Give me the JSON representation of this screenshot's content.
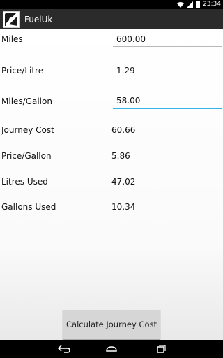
{
  "status_bar": {
    "time": "23:34",
    "icons": [
      "wifi-icon",
      "signal-icon",
      "battery-icon"
    ]
  },
  "action_bar": {
    "title": "FuelUk",
    "icon": "fuel-pump-icon"
  },
  "inputs": {
    "miles": {
      "label": "Miles",
      "value": "600.00"
    },
    "price_litre": {
      "label": "Price/Litre",
      "value": "1.29"
    },
    "miles_gallon": {
      "label": "Miles/Gallon",
      "value": "58.00"
    }
  },
  "results": {
    "journey_cost": {
      "label": "Journey Cost",
      "value": "60.66"
    },
    "price_gallon": {
      "label": "Price/Gallon",
      "value": "5.86"
    },
    "litres_used": {
      "label": "Litres Used",
      "value": "47.02"
    },
    "gallons_used": {
      "label": "Gallons Used",
      "value": "10.34"
    }
  },
  "button": {
    "label": "Calculate Journey Cost"
  },
  "nav_bar": {
    "icons": [
      "back-icon",
      "home-icon",
      "recents-icon"
    ]
  },
  "colors": {
    "accent": "#33b5e5",
    "action_bar": "#2b2b2b"
  }
}
